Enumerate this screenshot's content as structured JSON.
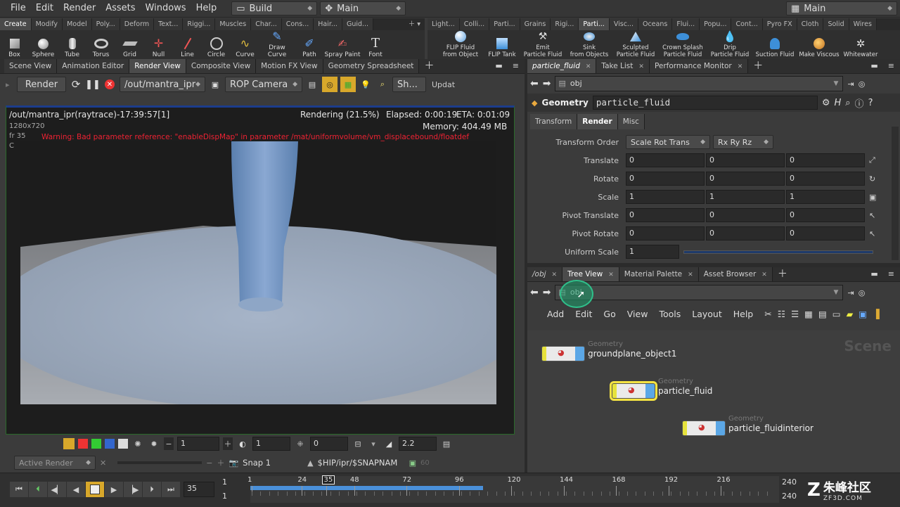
{
  "menubar": {
    "items": [
      "File",
      "Edit",
      "Render",
      "Assets",
      "Windows",
      "Help"
    ],
    "desktop_label": "Build",
    "network_label": "Main",
    "main_label": "Main"
  },
  "shelf_left": {
    "tabs": [
      "Create",
      "Modify",
      "Model",
      "Poly...",
      "Deform",
      "Text...",
      "Riggi...",
      "Muscles",
      "Char...",
      "Cons...",
      "Hair...",
      "Guid..."
    ],
    "tools": [
      "Box",
      "Sphere",
      "Tube",
      "Torus",
      "Grid",
      "Null",
      "Line",
      "Circle",
      "Curve",
      "Draw Curve",
      "Path",
      "Spray Paint",
      "Font"
    ]
  },
  "shelf_right": {
    "tabs": [
      "Light...",
      "Colli...",
      "Parti...",
      "Grains",
      "Rigi...",
      "Parti...",
      "Visc...",
      "Oceans",
      "Flui...",
      "Popu...",
      "Cont...",
      "Pyro FX",
      "Cloth",
      "Solid",
      "Wires"
    ],
    "tools": [
      {
        "l1": "FLIP Fluid",
        "l2": "from Object"
      },
      {
        "l1": "FLIP Tank",
        "l2": ""
      },
      {
        "l1": "Emit",
        "l2": "Particle Fluid"
      },
      {
        "l1": "Sink",
        "l2": "from Objects"
      },
      {
        "l1": "Sculpted",
        "l2": "Particle Fluid"
      },
      {
        "l1": "Crown Splash",
        "l2": "Particle Fluid"
      },
      {
        "l1": "Drip",
        "l2": "Particle Fluid"
      },
      {
        "l1": "Suction Fluid",
        "l2": ""
      },
      {
        "l1": "Make Viscous",
        "l2": ""
      },
      {
        "l1": "Whitewater",
        "l2": ""
      }
    ]
  },
  "viewer": {
    "tabs": [
      "Scene View",
      "Animation Editor",
      "Render View",
      "Composite View",
      "Motion FX View",
      "Geometry Spreadsheet"
    ],
    "render_button": "Render",
    "rop_path": "/out/mantra_ipr",
    "camera": "ROP Camera",
    "sh_label": "Sh...",
    "update_label": "Updat",
    "path_line": "/out/mantra_ipr(raytrace)-17:39:57[1]",
    "resolution": "1280x720",
    "frame": "fr 35",
    "channel": "C",
    "status": "Rendering (21.5%)",
    "elapsed": "Elapsed: 0:00:19",
    "eta": "ETA: 0:01:09",
    "memory": "Memory:  404.49 MB",
    "warning": "Warning:    Bad parameter reference: \"enableDispMap\" in parameter /mat/uniformvolume/vm_displacebound/floatdef",
    "bottom": {
      "field1": "1",
      "field2": "1",
      "field3": "0",
      "field4": "2.2"
    },
    "active_render": "Active Render",
    "snap": "Snap  1",
    "snap_path": "$HIP/ipr/$SNAPNAM",
    "snap_num": "60"
  },
  "params": {
    "tabs": [
      "particle_fluid",
      "Take List",
      "Performance Monitor"
    ],
    "path": "obj",
    "node_type": "Geometry",
    "node_name": "particle_fluid",
    "subtabs": [
      "Transform",
      "Render",
      "Misc"
    ],
    "transform_order_label": "Transform Order",
    "transform_order": "Scale Rot Trans",
    "rot_order": "Rx Ry Rz",
    "rows": [
      {
        "label": "Translate",
        "v": [
          "0",
          "0",
          "0"
        ]
      },
      {
        "label": "Rotate",
        "v": [
          "0",
          "0",
          "0"
        ]
      },
      {
        "label": "Scale",
        "v": [
          "1",
          "1",
          "1"
        ]
      },
      {
        "label": "Pivot Translate",
        "v": [
          "0",
          "0",
          "0"
        ]
      },
      {
        "label": "Pivot Rotate",
        "v": [
          "0",
          "0",
          "0"
        ]
      }
    ],
    "uniform_scale_label": "Uniform Scale",
    "uniform_scale": "1"
  },
  "network": {
    "tabs": [
      "/obj",
      "Tree View",
      "Material Palette",
      "Asset Browser"
    ],
    "path": "obj",
    "menu": [
      "Add",
      "Edit",
      "Go",
      "View",
      "Tools",
      "Layout",
      "Help"
    ],
    "watermark": "Scene",
    "nodes": [
      {
        "type": "Geometry",
        "name": "groundplane_object1"
      },
      {
        "type": "Geometry",
        "name": "particle_fluid"
      },
      {
        "type": "Geometry",
        "name": "particle_fluidinterior"
      }
    ]
  },
  "timeline": {
    "current_frame": "35",
    "start": "1",
    "start2": "1",
    "ticks": [
      "1",
      "24",
      "35",
      "48",
      "72",
      "96",
      "120",
      "144",
      "168",
      "192",
      "216"
    ],
    "end1": "240",
    "end2": "240",
    "cache_progress": 0.44,
    "logo": "ZF3D.COM",
    "logo_cn": "朱峰社区"
  }
}
